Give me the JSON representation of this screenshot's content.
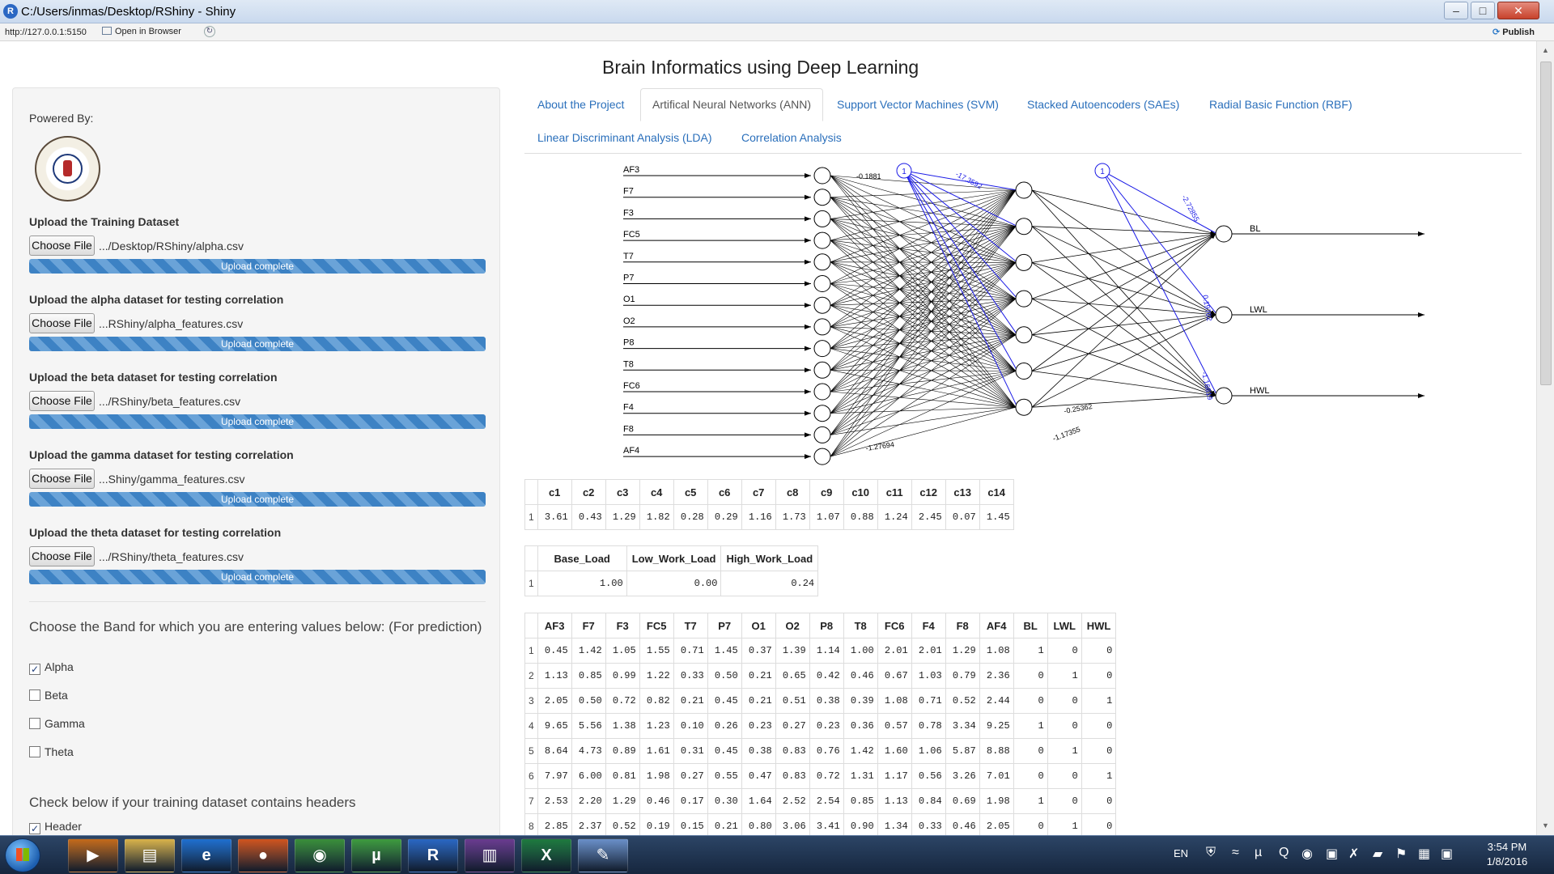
{
  "window": {
    "title": "C:/Users/inmas/Desktop/RShiny - Shiny",
    "url": "http://127.0.0.1:5150",
    "open_in_browser": "Open in Browser",
    "publish": "Publish"
  },
  "page": {
    "title": "Brain Informatics using Deep Learning"
  },
  "sidebar": {
    "powered_by": "Powered By:",
    "uploads": [
      {
        "label": "Upload the Training Dataset",
        "button": "Choose File",
        "file": ".../Desktop/RShiny/alpha.csv",
        "status": "Upload complete"
      },
      {
        "label": "Upload the alpha dataset for testing correlation",
        "button": "Choose File",
        "file": "...RShiny/alpha_features.csv",
        "status": "Upload complete"
      },
      {
        "label": "Upload the beta dataset for testing correlation",
        "button": "Choose File",
        "file": ".../RShiny/beta_features.csv",
        "status": "Upload complete"
      },
      {
        "label": "Upload the gamma dataset for testing correlation",
        "button": "Choose File",
        "file": "...Shiny/gamma_features.csv",
        "status": "Upload complete"
      },
      {
        "label": "Upload the theta dataset for testing correlation",
        "button": "Choose File",
        "file": ".../RShiny/theta_features.csv",
        "status": "Upload complete"
      }
    ],
    "band_prompt": "Choose the Band for which you are entering values below: (For prediction)",
    "bands": [
      {
        "label": "Alpha",
        "checked": true
      },
      {
        "label": "Beta",
        "checked": false
      },
      {
        "label": "Gamma",
        "checked": false
      },
      {
        "label": "Theta",
        "checked": false
      }
    ],
    "header_prompt": "Check below if your training dataset contains headers",
    "header_check": {
      "label": "Header",
      "checked": true
    }
  },
  "tabs": [
    {
      "label": "About the Project",
      "active": false
    },
    {
      "label": "Artifical Neural Networks (ANN)",
      "active": true
    },
    {
      "label": "Support Vector Machines (SVM)",
      "active": false
    },
    {
      "label": "Stacked Autoencoders (SAEs)",
      "active": false
    },
    {
      "label": "Radial Basic Function (RBF)",
      "active": false
    },
    {
      "label": "Linear Discriminant Analysis (LDA)",
      "active": false
    },
    {
      "label": "Correlation Analysis",
      "active": false
    }
  ],
  "nn": {
    "inputs": [
      "AF3",
      "F7",
      "F3",
      "FC5",
      "T7",
      "P7",
      "O1",
      "O2",
      "P8",
      "T8",
      "FC6",
      "F4",
      "F8",
      "AF4"
    ],
    "outputs": [
      "BL",
      "LWL",
      "HWL"
    ],
    "bias_label": "1",
    "weight_labels": [
      "-0.1881",
      "-17.3592",
      "-2.72855",
      "0.19702",
      "-1.16819",
      "-0.25362",
      "-1.17355",
      "-1.27694"
    ]
  },
  "table1": {
    "columns": [
      "",
      "c1",
      "c2",
      "c3",
      "c4",
      "c5",
      "c6",
      "c7",
      "c8",
      "c9",
      "c10",
      "c11",
      "c12",
      "c13",
      "c14"
    ],
    "rows": [
      [
        "1",
        "3.61",
        "0.43",
        "1.29",
        "1.82",
        "0.28",
        "0.29",
        "1.16",
        "1.73",
        "1.07",
        "0.88",
        "1.24",
        "2.45",
        "0.07",
        "1.45"
      ]
    ]
  },
  "table2": {
    "columns": [
      "",
      "Base_Load",
      "Low_Work_Load",
      "High_Work_Load"
    ],
    "rows": [
      [
        "1",
        "1.00",
        "0.00",
        "0.24"
      ]
    ]
  },
  "table3": {
    "columns": [
      "",
      "AF3",
      "F7",
      "F3",
      "FC5",
      "T7",
      "P7",
      "O1",
      "O2",
      "P8",
      "T8",
      "FC6",
      "F4",
      "F8",
      "AF4",
      "BL",
      "LWL",
      "HWL"
    ],
    "rows": [
      [
        "1",
        "0.45",
        "1.42",
        "1.05",
        "1.55",
        "0.71",
        "1.45",
        "0.37",
        "1.39",
        "1.14",
        "1.00",
        "2.01",
        "2.01",
        "1.29",
        "1.08",
        "1",
        "0",
        "0"
      ],
      [
        "2",
        "1.13",
        "0.85",
        "0.99",
        "1.22",
        "0.33",
        "0.50",
        "0.21",
        "0.65",
        "0.42",
        "0.46",
        "0.67",
        "1.03",
        "0.79",
        "2.36",
        "0",
        "1",
        "0"
      ],
      [
        "3",
        "2.05",
        "0.50",
        "0.72",
        "0.82",
        "0.21",
        "0.45",
        "0.21",
        "0.51",
        "0.38",
        "0.39",
        "1.08",
        "0.71",
        "0.52",
        "2.44",
        "0",
        "0",
        "1"
      ],
      [
        "4",
        "9.65",
        "5.56",
        "1.38",
        "1.23",
        "0.10",
        "0.26",
        "0.23",
        "0.27",
        "0.23",
        "0.36",
        "0.57",
        "0.78",
        "3.34",
        "9.25",
        "1",
        "0",
        "0"
      ],
      [
        "5",
        "8.64",
        "4.73",
        "0.89",
        "1.61",
        "0.31",
        "0.45",
        "0.38",
        "0.83",
        "0.76",
        "1.42",
        "1.60",
        "1.06",
        "5.87",
        "8.88",
        "0",
        "1",
        "0"
      ],
      [
        "6",
        "7.97",
        "6.00",
        "0.81",
        "1.98",
        "0.27",
        "0.55",
        "0.47",
        "0.83",
        "0.72",
        "1.31",
        "1.17",
        "0.56",
        "3.26",
        "7.01",
        "0",
        "0",
        "1"
      ],
      [
        "7",
        "2.53",
        "2.20",
        "1.29",
        "0.46",
        "0.17",
        "0.30",
        "1.64",
        "2.52",
        "2.54",
        "0.85",
        "1.13",
        "0.84",
        "0.69",
        "1.98",
        "1",
        "0",
        "0"
      ],
      [
        "8",
        "2.85",
        "2.37",
        "0.52",
        "0.19",
        "0.15",
        "0.21",
        "0.80",
        "3.06",
        "3.41",
        "0.90",
        "1.34",
        "0.33",
        "0.46",
        "2.05",
        "0",
        "1",
        "0"
      ]
    ]
  },
  "taskbar": {
    "apps": [
      "media-player",
      "explorer",
      "internet-explorer",
      "firefox",
      "chrome",
      "utorrent",
      "rstudio",
      "winrar",
      "excel",
      "paint"
    ],
    "app_glyphs": [
      "▶",
      "▤",
      "e",
      "●",
      "◉",
      "µ",
      "R",
      "▥",
      "X",
      "✎"
    ],
    "language": "EN",
    "time": "3:54 PM",
    "date": "1/8/2016"
  },
  "colors": {
    "link": "#2a6fbb",
    "progress": "#3d82c4",
    "bias_edge": "#1a1ae6"
  }
}
